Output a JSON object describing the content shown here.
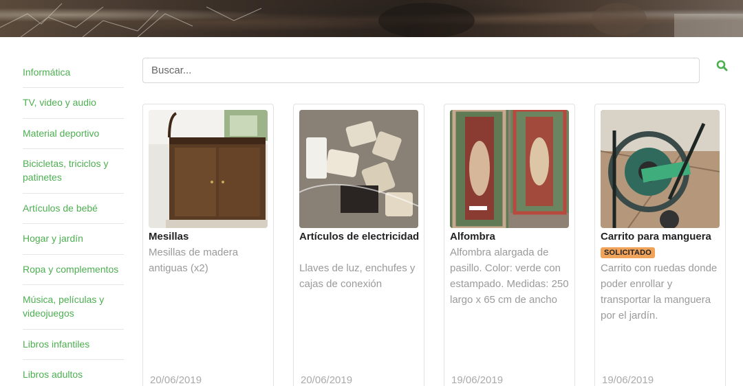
{
  "sidebar": {
    "categories": [
      "Informática",
      "TV, video y audio",
      "Material deportivo",
      "Bicicletas, triciclos y patinetes",
      "Artículos de bebé",
      "Hogar y jardín",
      "Ropa y complementos",
      "Música, películas y videojuegos",
      "Libros infantiles",
      "Libros adultos"
    ]
  },
  "search": {
    "placeholder": "Buscar...",
    "value": "",
    "button_icon": "search-icon"
  },
  "accent_color": "#4caf50",
  "badge_color": "#f0a35a",
  "products": [
    {
      "title": "Mesillas",
      "description": "Mesillas de madera antiguas (x2)",
      "status": "",
      "date": "20/06/2019",
      "image": "wooden-cabinet-photo"
    },
    {
      "title": "Artículos de electricidad",
      "description": "Llaves de luz, enchufes y cajas de conexión",
      "status": "",
      "date": "20/06/2019",
      "image": "electrical-parts-photo"
    },
    {
      "title": "Alfombra",
      "description": "Alfombra alargada de pasillo. Color: verde con estampado. Medidas: 250 largo x 65 cm de ancho",
      "status": "",
      "date": "19/06/2019",
      "image": "rug-photo"
    },
    {
      "title": "Carrito para manguera",
      "description": "Carrito con ruedas donde poder enrollar y transportar la manguera por el jardín.",
      "status": "SOLICITADO",
      "date": "19/06/2019",
      "image": "hose-reel-photo"
    }
  ]
}
